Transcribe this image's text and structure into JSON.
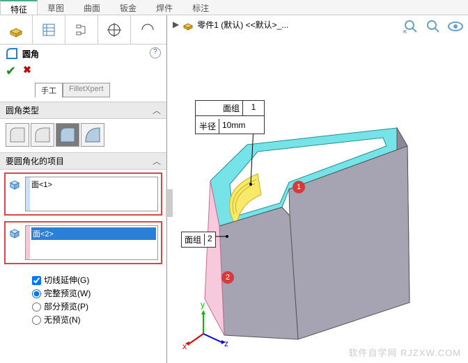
{
  "tabs": {
    "features": "特征",
    "sketch": "草图",
    "surface": "曲面",
    "sheetmetal": "钣金",
    "weldments": "焊件",
    "annotate": "标注"
  },
  "breadcrumb": {
    "part": "零件1 (默认) <<默认>_..."
  },
  "feature": {
    "title": "圆角"
  },
  "modes": {
    "manual": "手工",
    "xpert": "FilletXpert"
  },
  "sections": {
    "type": "圆角类型",
    "items": "要圆角化的项目"
  },
  "items": {
    "face1": "面<1>",
    "face2": "面<2>"
  },
  "options": {
    "tangent": "切线延伸(G)",
    "full": "完整预览(W)",
    "partial": "部分预览(P)",
    "none": "无预览(N)"
  },
  "viewport": {
    "callout_group1_label": "面组",
    "callout_group1_value": "1",
    "callout_radius_label": "半径",
    "callout_radius_value": "10mm",
    "callout_group2_label": "面组",
    "callout_group2_value": "2",
    "marker1": "1",
    "marker2": "2"
  },
  "watermark": "软件自学网  RJZXW.COM"
}
